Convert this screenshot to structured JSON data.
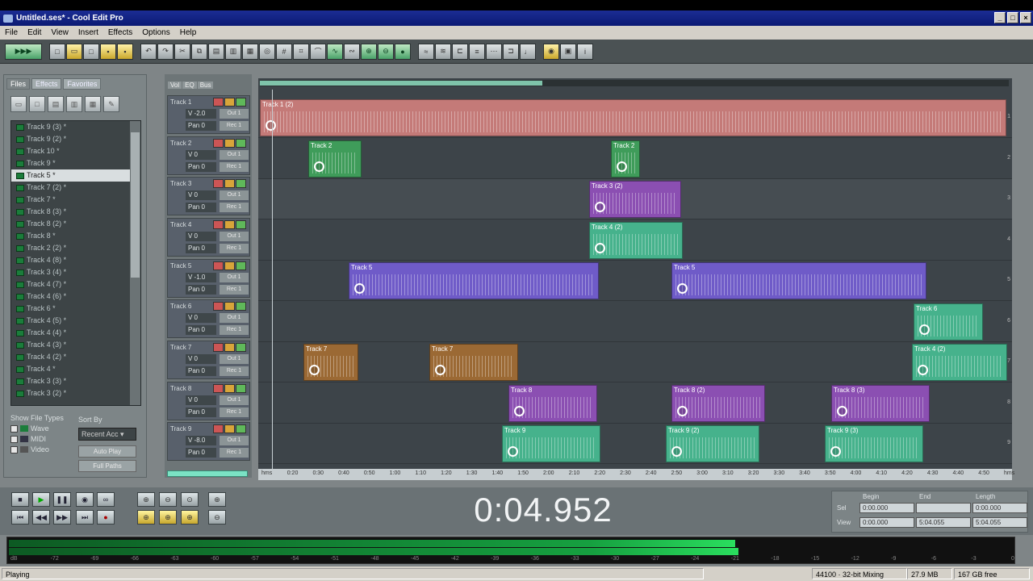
{
  "window": {
    "title": "Untitled.ses* - Cool Edit Pro"
  },
  "menu": [
    "File",
    "Edit",
    "View",
    "Insert",
    "Effects",
    "Options",
    "Help"
  ],
  "left_panel": {
    "tabs": [
      "Files",
      "Effects",
      "Favorites"
    ],
    "files": [
      "Track 9 (3) *",
      "Track 9 (2) *",
      "Track 10 *",
      "Track 9 *",
      "Track 5 *",
      "Track 7 (2) *",
      "Track 7 *",
      "Track 8 (3) *",
      "Track 8 (2) *",
      "Track 8 *",
      "Track 2 (2) *",
      "Track 4 (8) *",
      "Track 3 (4) *",
      "Track 4 (7) *",
      "Track 4 (6) *",
      "Track 6 *",
      "Track 4 (5) *",
      "Track 4 (4) *",
      "Track 4 (3) *",
      "Track 4 (2) *",
      "Track 4 *",
      "Track 3 (3) *",
      "Track 3 (2) *"
    ],
    "selected_index": 4,
    "show_file_types_label": "Show File Types",
    "types": [
      "Wave",
      "MIDI",
      "Video"
    ],
    "sort_by_label": "Sort By",
    "sort_value": "Recent Acc",
    "btn_autoplay": "Auto Play",
    "btn_full_paths": "Full Paths"
  },
  "tracks": [
    {
      "name": "Track 1",
      "vol": "V -2.0",
      "pan": "Pan 0"
    },
    {
      "name": "Track 2",
      "vol": "V 0",
      "pan": "Pan 0"
    },
    {
      "name": "Track 3",
      "vol": "V 0",
      "pan": "Pan 0"
    },
    {
      "name": "Track 4",
      "vol": "V 0",
      "pan": "Pan 0"
    },
    {
      "name": "Track 5",
      "vol": "V -1.0",
      "pan": "Pan 0"
    },
    {
      "name": "Track 6",
      "vol": "V 0",
      "pan": "Pan 0"
    },
    {
      "name": "Track 7",
      "vol": "V 0",
      "pan": "Pan 0"
    },
    {
      "name": "Track 8",
      "vol": "V 0",
      "pan": "Pan 0"
    },
    {
      "name": "Track 9",
      "vol": "V -8.0",
      "pan": "Pan 0"
    }
  ],
  "track_buttons": {
    "out": "Out 1",
    "rec": "Rec 1"
  },
  "header_tabs": [
    "Vol",
    "EQ",
    "Bus"
  ],
  "timeline_labels": [
    "hms",
    "0:20",
    "0:30",
    "0:40",
    "0:50",
    "1:00",
    "1:10",
    "1:20",
    "1:30",
    "1:40",
    "1:50",
    "2:00",
    "2:10",
    "2:20",
    "2:30",
    "2:40",
    "2:50",
    "3:00",
    "3:10",
    "3:20",
    "3:30",
    "3:40",
    "3:50",
    "4:00",
    "4:10",
    "4:20",
    "4:30",
    "4:40",
    "4:50",
    "hms"
  ],
  "clips": [
    {
      "track": 0,
      "label": "Track 1 (2)",
      "color": "red"
    },
    {
      "track": 1,
      "label": "Track 2",
      "color": "green"
    },
    {
      "track": 1,
      "label": "Track 2",
      "color": "green"
    },
    {
      "track": 2,
      "label": "Track 3 (2)",
      "color": "purple"
    },
    {
      "track": 3,
      "label": "Track 4 (2)",
      "color": "mint"
    },
    {
      "track": 4,
      "label": "Track 5",
      "color": "violet"
    },
    {
      "track": 4,
      "label": "Track 5",
      "color": "violet"
    },
    {
      "track": 5,
      "label": "Track 6",
      "color": "mint"
    },
    {
      "track": 6,
      "label": "Track 7",
      "color": "brown"
    },
    {
      "track": 6,
      "label": "Track 7",
      "color": "brown"
    },
    {
      "track": 6,
      "label": "Track 4 (2)",
      "color": "mint"
    },
    {
      "track": 7,
      "label": "Track 8",
      "color": "purple"
    },
    {
      "track": 7,
      "label": "Track 8 (2)",
      "color": "purple"
    },
    {
      "track": 7,
      "label": "Track 8 (3)",
      "color": "purple"
    },
    {
      "track": 8,
      "label": "Track 9",
      "color": "mint"
    },
    {
      "track": 8,
      "label": "Track 9 (2)",
      "color": "mint"
    },
    {
      "track": 8,
      "label": "Track 9 (3)",
      "color": "mint"
    }
  ],
  "time_display": "0:04.952",
  "selection": {
    "headers": [
      "Begin",
      "End",
      "Length"
    ],
    "row_labels": [
      "Sel",
      "View"
    ],
    "sel": [
      "0:00.000",
      "",
      "0:00.000"
    ],
    "view": [
      "0:00.000",
      "5:04.055",
      "5:04.055"
    ]
  },
  "meter_scale": [
    "dB",
    "-72",
    "-69",
    "-66",
    "-63",
    "-60",
    "-57",
    "-54",
    "-51",
    "-48",
    "-45",
    "-42",
    "-39",
    "-36",
    "-33",
    "-30",
    "-27",
    "-24",
    "-21",
    "-18",
    "-15",
    "-12",
    "-9",
    "-6",
    "-3",
    "0"
  ],
  "status": {
    "state": "Playing",
    "format": "44100 · 32-bit Mixing",
    "mem": "27.9 MB",
    "free": "167 GB free"
  },
  "colors": {
    "accent": "#1b2d94",
    "meter": "#16a040"
  }
}
